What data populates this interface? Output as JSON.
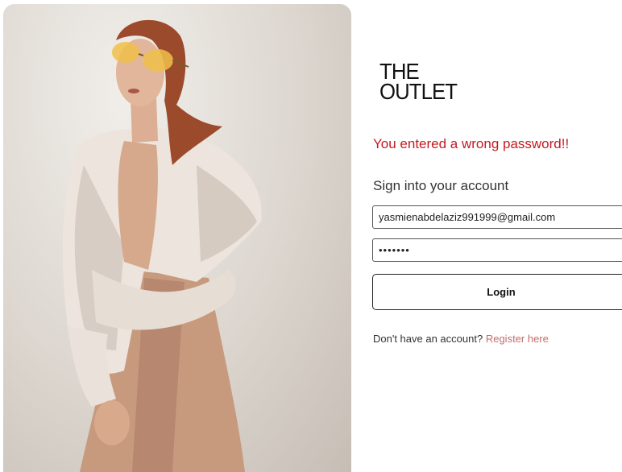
{
  "brand": {
    "line1": "THE",
    "line2": "OUTLET"
  },
  "alert": {
    "error_message": "You entered a wrong password!!"
  },
  "login_form": {
    "title": "Sign into your account",
    "email_value": "yasmienabdelaziz991999@gmail.com",
    "password_value": "•••••••",
    "login_label": "Login"
  },
  "register": {
    "prompt": "Don't have an account?",
    "link_label": "Register here"
  },
  "colors": {
    "error": "#c41a22",
    "link": "#c56d6f"
  }
}
